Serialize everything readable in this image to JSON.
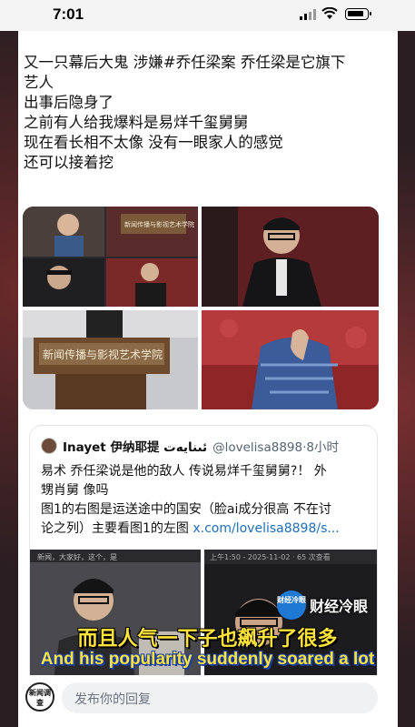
{
  "status_bar": {
    "time": "7:01"
  },
  "post": {
    "lines": [
      "又一只幕后大鬼 涉嫌#乔任梁案 乔任梁是它旗下",
      "艺人",
      "出事后隐身了",
      "之前有人给我爆料是易烊千玺舅舅",
      "现在看长相不太像 没有一眼家人的感觉",
      "还可以接着挖"
    ]
  },
  "media": {
    "sign_text_1": "新闻传播与影视艺术学院",
    "sign_text_2": "新闻传播与影视艺术学院"
  },
  "quote": {
    "name": "Inayet 伊纳耶提 ئىنايەت",
    "handle": "@lovelisa8898·8小时",
    "body_lines": [
      "易术 乔任梁说是他的敌人 传说易烊千玺舅舅?！ 外",
      "甥肖舅 像吗",
      "图1的右图是运送途中的国安（脸ai成分很高 不在讨",
      "论之列）主要看图1的左图 "
    ],
    "link": "x.com/lovelisa8898/s...",
    "media_header": "上午1:50 - 2025-11-02 · 65 次查看",
    "media_caption": "新闻，大家好，这个，是"
  },
  "watermark": {
    "badge": "财经冷眼",
    "text": "财经冷眼"
  },
  "subtitles": {
    "cn": "而且人气一下子也飙升了很多",
    "en": "And his popularity suddenly soared a lot"
  },
  "reply": {
    "logo": "新闻调查",
    "placeholder": "发布你的回复"
  },
  "colors": {
    "subtitle": "#ffe33a",
    "link": "#1d6fb8",
    "subtitle_outline_en": "#1a3fa3"
  }
}
